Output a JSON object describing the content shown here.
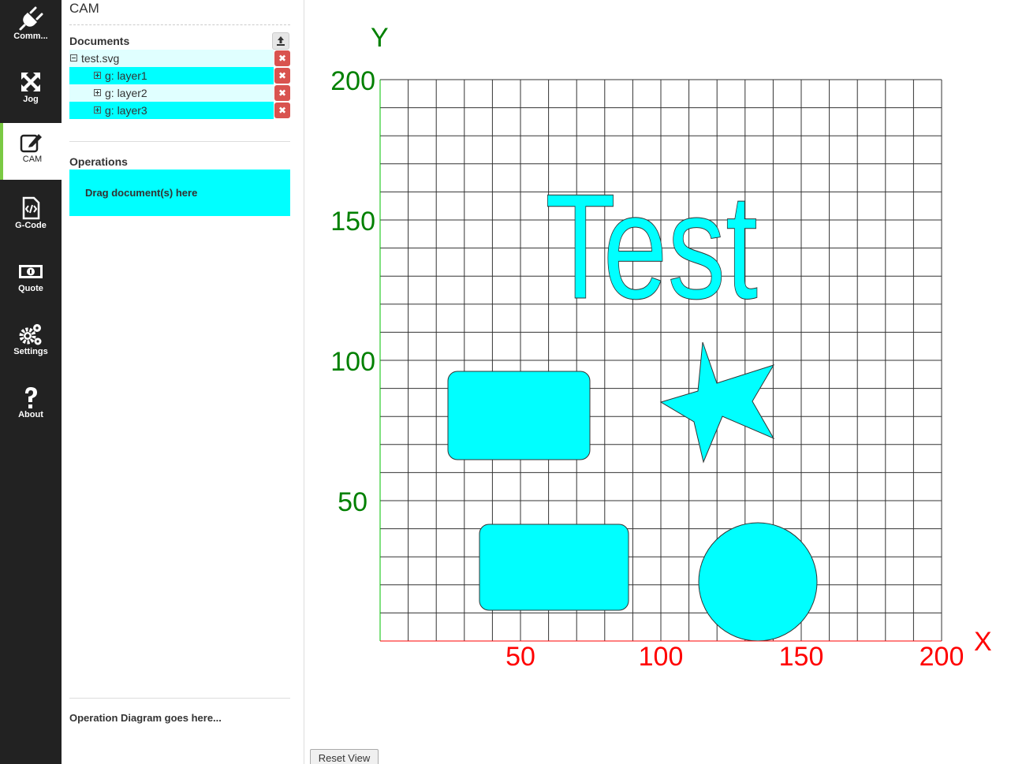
{
  "nav": {
    "items": [
      {
        "label": "Comm...",
        "icon": "plug-icon"
      },
      {
        "label": "Jog",
        "icon": "move-arrows-icon"
      },
      {
        "label": "CAM",
        "icon": "edit-icon"
      },
      {
        "label": "G-Code",
        "icon": "code-file-icon"
      },
      {
        "label": "Quote",
        "icon": "money-icon"
      },
      {
        "label": "Settings",
        "icon": "gears-icon"
      },
      {
        "label": "About",
        "icon": "question-icon"
      }
    ],
    "active": "CAM",
    "active_color": "#7ac943"
  },
  "panel": {
    "title": "CAM",
    "documents": {
      "heading": "Documents",
      "file": "test.svg",
      "layers": [
        "g: layer1",
        "g: layer2",
        "g: layer3"
      ],
      "delete_symbol": "✖"
    },
    "operations": {
      "heading": "Operations",
      "drop_text": "Drag document(s) here"
    },
    "diagram_text": "Operation Diagram goes here..."
  },
  "canvas": {
    "axis_labels": {
      "x": "X",
      "y": "Y"
    },
    "x_ticks": [
      "50",
      "100",
      "150",
      "200"
    ],
    "y_ticks": [
      "200",
      "150",
      "100",
      "50"
    ],
    "text_shape": "Test",
    "shape_fill": "#00ffff",
    "x_axis_color": "#ff0000",
    "y_axis_color": "#008000",
    "reset_label": "Reset View"
  }
}
